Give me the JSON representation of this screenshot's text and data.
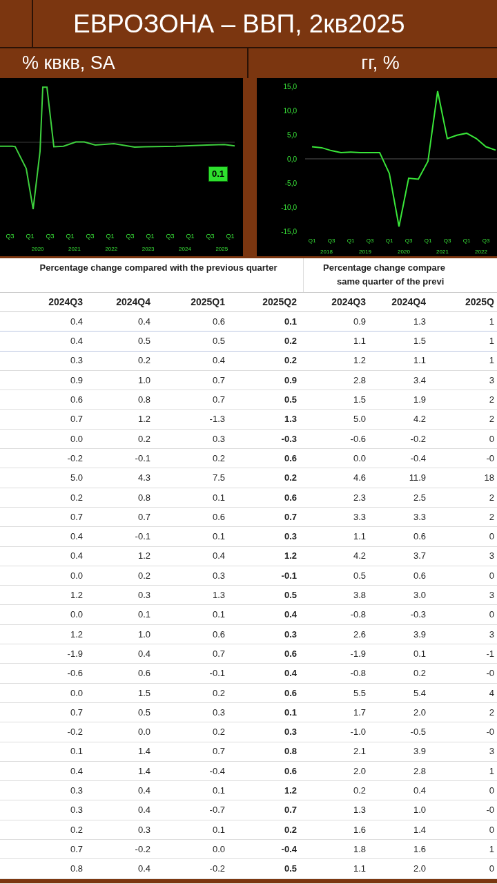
{
  "title": "ЕВРОЗОНА – ВВП, 2кв2025",
  "panels": [
    {
      "heading": "% квкв, SA"
    },
    {
      "heading": "гг, %"
    }
  ],
  "left_chart": {
    "badge": "0.1",
    "quarter_labels": [
      "Q3",
      "Q1",
      "Q3",
      "Q1",
      "Q3",
      "Q1",
      "Q3",
      "Q1",
      "Q3",
      "Q1",
      "Q3",
      "Q1"
    ],
    "year_labels": [
      "2020",
      "2021",
      "2022",
      "2023",
      "2024",
      "2025"
    ]
  },
  "right_chart": {
    "year_labels": [
      "2018",
      "2019",
      "2020",
      "2021",
      "2022"
    ],
    "chart_data": {
      "type": "line",
      "categories": [
        "Q1",
        null,
        "Q3",
        null,
        "Q1",
        null,
        "Q3",
        null,
        "Q1",
        null,
        "Q3",
        null,
        "Q1",
        null,
        "Q3",
        null,
        "Q1",
        null,
        "Q3",
        null
      ],
      "series": [
        {
          "color": "#39e639",
          "values": [
            2.5,
            2.3,
            1.7,
            1.3,
            1.4,
            1.3,
            1.3,
            1.3,
            -3.0,
            -14.0,
            -4.0,
            -4.2,
            -0.5,
            14.0,
            4.2,
            4.9,
            5.3,
            4.2,
            2.5,
            1.8
          ]
        }
      ],
      "ylim": [
        -15,
        15
      ],
      "yticks": [
        {
          "value": 15,
          "label": "15,0"
        },
        {
          "value": 10,
          "label": "10,0"
        },
        {
          "value": 5,
          "label": "5,0"
        },
        {
          "value": 0,
          "label": "0,0"
        },
        {
          "value": -5,
          "label": "-5,0"
        },
        {
          "value": -10,
          "label": "-10,0"
        },
        {
          "value": -15,
          "label": "-15,0"
        }
      ]
    }
  },
  "table": {
    "group_headings": [
      [
        "Percentage change compared with the previous quarter"
      ],
      [
        "Percentage change compare",
        "same quarter of the previ"
      ]
    ],
    "columns": [
      "2024Q3",
      "2024Q4",
      "2025Q1",
      "2025Q2",
      "2024Q3",
      "2024Q4",
      "2025Q"
    ],
    "rows": [
      [
        "0.4",
        "0.4",
        "0.6",
        "0.1",
        "0.9",
        "1.3",
        "1"
      ],
      [
        "0.4",
        "0.5",
        "0.5",
        "0.2",
        "1.1",
        "1.5",
        "1"
      ],
      [
        "0.3",
        "0.2",
        "0.4",
        "0.2",
        "1.2",
        "1.1",
        "1"
      ],
      [
        "0.9",
        "1.0",
        "0.7",
        "0.9",
        "2.8",
        "3.4",
        "3"
      ],
      [
        "0.6",
        "0.8",
        "0.7",
        "0.5",
        "1.5",
        "1.9",
        "2"
      ],
      [
        "0.7",
        "1.2",
        "-1.3",
        "1.3",
        "5.0",
        "4.2",
        "2"
      ],
      [
        "0.0",
        "0.2",
        "0.3",
        "-0.3",
        "-0.6",
        "-0.2",
        "0"
      ],
      [
        "-0.2",
        "-0.1",
        "0.2",
        "0.6",
        "0.0",
        "-0.4",
        "-0"
      ],
      [
        "5.0",
        "4.3",
        "7.5",
        "0.2",
        "4.6",
        "11.9",
        "18"
      ],
      [
        "0.2",
        "0.8",
        "0.1",
        "0.6",
        "2.3",
        "2.5",
        "2"
      ],
      [
        "0.7",
        "0.7",
        "0.6",
        "0.7",
        "3.3",
        "3.3",
        "2"
      ],
      [
        "0.4",
        "-0.1",
        "0.1",
        "0.3",
        "1.1",
        "0.6",
        "0"
      ],
      [
        "0.4",
        "1.2",
        "0.4",
        "1.2",
        "4.2",
        "3.7",
        "3"
      ],
      [
        "0.0",
        "0.2",
        "0.3",
        "-0.1",
        "0.5",
        "0.6",
        "0"
      ],
      [
        "1.2",
        "0.3",
        "1.3",
        "0.5",
        "3.8",
        "3.0",
        "3"
      ],
      [
        "0.0",
        "0.1",
        "0.1",
        "0.4",
        "-0.8",
        "-0.3",
        "0"
      ],
      [
        "1.2",
        "1.0",
        "0.6",
        "0.3",
        "2.6",
        "3.9",
        "3"
      ],
      [
        "-1.9",
        "0.4",
        "0.7",
        "0.6",
        "-1.9",
        "0.1",
        "-1"
      ],
      [
        "-0.6",
        "0.6",
        "-0.1",
        "0.4",
        "-0.8",
        "0.2",
        "-0"
      ],
      [
        "0.0",
        "1.5",
        "0.2",
        "0.6",
        "5.5",
        "5.4",
        "4"
      ],
      [
        "0.7",
        "0.5",
        "0.3",
        "0.1",
        "1.7",
        "2.0",
        "2"
      ],
      [
        "-0.2",
        "0.0",
        "0.2",
        "0.3",
        "-1.0",
        "-0.5",
        "-0"
      ],
      [
        "0.1",
        "1.4",
        "0.7",
        "0.8",
        "2.1",
        "3.9",
        "3"
      ],
      [
        "0.4",
        "1.4",
        "-0.4",
        "0.6",
        "2.0",
        "2.8",
        "1"
      ],
      [
        "0.3",
        "0.4",
        "0.1",
        "1.2",
        "0.2",
        "0.4",
        "0"
      ],
      [
        "0.3",
        "0.4",
        "-0.7",
        "0.7",
        "1.3",
        "1.0",
        "-0"
      ],
      [
        "0.2",
        "0.3",
        "0.1",
        "0.2",
        "1.6",
        "1.4",
        "0"
      ],
      [
        "0.7",
        "-0.2",
        "0.0",
        "-0.4",
        "1.8",
        "1.6",
        "1"
      ],
      [
        "0.8",
        "0.4",
        "-0.2",
        "0.5",
        "1.1",
        "2.0",
        "0"
      ]
    ]
  }
}
